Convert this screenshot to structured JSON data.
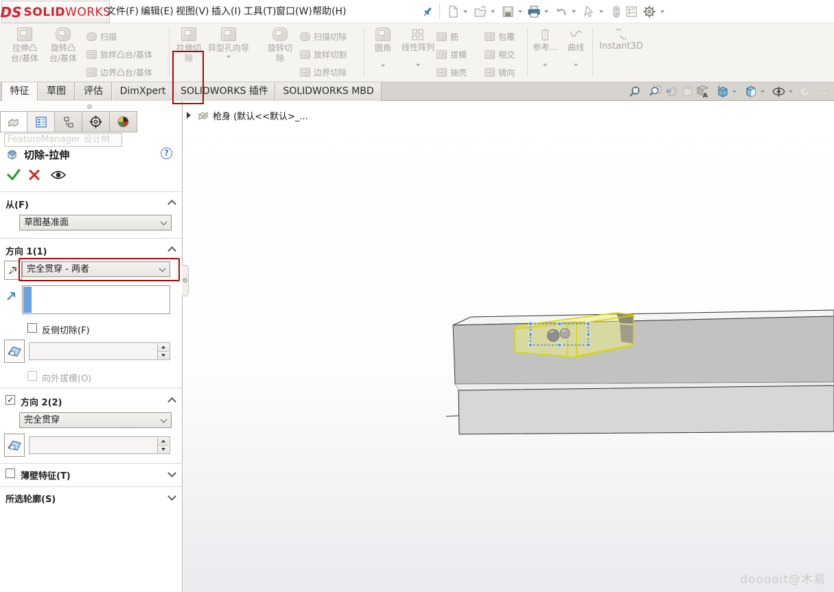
{
  "menubar": {
    "logo_monogram": "DS",
    "logo_solid": "SOLID",
    "logo_works": "WORKS",
    "items": [
      "文件(F)",
      "编辑(E)",
      "视图(V)",
      "插入(I)",
      "工具(T)",
      "窗口(W)",
      "帮助(H)"
    ],
    "quick_access_icons": [
      "pin-icon",
      "new-document-icon",
      "open-icon",
      "save-icon",
      "print-icon",
      "undo-icon",
      "select-icon",
      "selection-filter-icon",
      "task-pane-icon",
      "options-gear-icon"
    ]
  },
  "ribbon": {
    "extrude_boss": {
      "line1": "拉伸凸",
      "line2": "台/基体"
    },
    "revolve_boss": {
      "line1": "旋转凸",
      "line2": "台/基体"
    },
    "swept_boss": "扫描",
    "loft_boss": "放样凸台/基体",
    "boundary_boss": "边界凸台/基体",
    "extruded_cut": {
      "line1": "拉伸切",
      "line2": "除"
    },
    "hole_wizard": "异型孔向导",
    "revolved_cut": {
      "line1": "旋转切",
      "line2": "除"
    },
    "swept_cut": "扫描切除",
    "lofted_cut": "放样切割",
    "boundary_cut": "边界切除",
    "fillet": "圆角",
    "linear_pattern": "线性阵列",
    "rib": "筋",
    "draft": "拔模",
    "shell": "抽壳",
    "wrap": "包覆",
    "intersect": "相交",
    "mirror": "镜向",
    "reference": "参考...",
    "curves": "曲线",
    "instant3d": "Instant3D"
  },
  "tabs": {
    "feature": "特征",
    "sketch": "草图",
    "evaluate": "评估",
    "dimxpert": "DimXpert",
    "addins": "SOLIDWORKS 插件",
    "mbd": "SOLIDWORKS MBD"
  },
  "headsup_icons": [
    "zoom-fit-icon",
    "zoom-area-icon",
    "previous-view-icon",
    "section-view-icon",
    "view-settings-icon",
    "view-orientation-icon",
    "display-style-icon",
    "hide-show-items-icon",
    "edit-appearance-icon",
    "scene-icon"
  ],
  "panel": {
    "tab_icons": [
      "featuremanager-tree-icon",
      "propertymanager-icon",
      "configuration-icon",
      "dimxpertmanager-icon",
      "appearances-icon"
    ],
    "ghost_tooltip": "FeatureManager 设计树",
    "title": "切除-拉伸",
    "help": "?",
    "actions": [
      "ok-check-icon",
      "cancel-x-icon",
      "preview-eye-icon"
    ],
    "from_label": "从(F)",
    "from_value": "草图基准面",
    "dir1_label": "方向 1(1)",
    "dir1_value": "完全贯穿 - 两者",
    "flip_side": "反侧切除(F)",
    "draft_outward": "向外拔模(O)",
    "dir2_label": "方向 2(2)",
    "dir2_value": "完全贯穿",
    "thin_feature": "薄壁特征(T)",
    "selected_contours": "所选轮廓(S)"
  },
  "viewport": {
    "tree_item": "枪身 (默认<<默认>_...",
    "watermark": "dooooit@木易"
  },
  "colors": {
    "annotation_red": "#b30000",
    "preview_yellow": "#d6d600",
    "selection_blue": "#4a90e0",
    "brand_red": "#d1232a"
  }
}
